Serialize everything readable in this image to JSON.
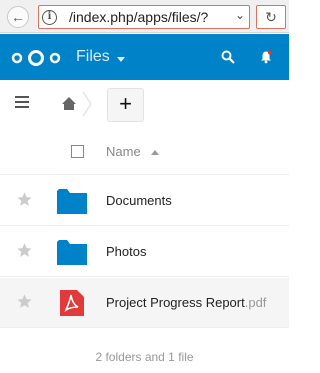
{
  "browser": {
    "url": "/index.php/apps/files/?",
    "back_glyph": "←",
    "info_glyph": "i",
    "drop_glyph": "⌄",
    "reload_glyph": "↻"
  },
  "header": {
    "app_name": "Files",
    "brand_color": "#0082c9"
  },
  "toolbar": {
    "new_label": "+"
  },
  "file_list": {
    "name_column": "Name",
    "rows": [
      {
        "name": "Documents",
        "ext": "",
        "type": "folder"
      },
      {
        "name": "Photos",
        "ext": "",
        "type": "folder"
      },
      {
        "name": "Project Progress Report",
        "ext": ".pdf",
        "type": "pdf"
      }
    ],
    "summary": "2 folders and 1 file"
  }
}
